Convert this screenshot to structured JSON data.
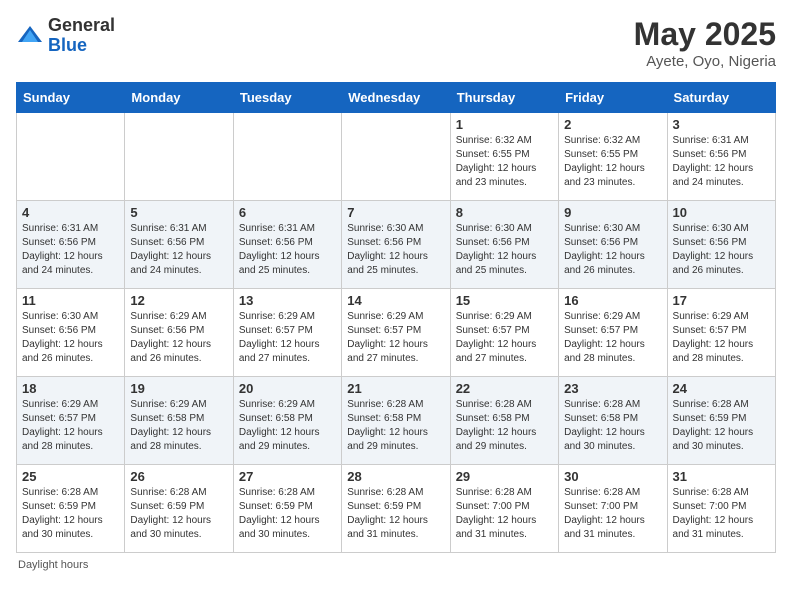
{
  "header": {
    "logo_general": "General",
    "logo_blue": "Blue",
    "month_title": "May 2025",
    "location": "Ayete, Oyo, Nigeria"
  },
  "footer": {
    "label": "Daylight hours"
  },
  "days_of_week": [
    "Sunday",
    "Monday",
    "Tuesday",
    "Wednesday",
    "Thursday",
    "Friday",
    "Saturday"
  ],
  "weeks": [
    [
      {
        "day": "",
        "info": ""
      },
      {
        "day": "",
        "info": ""
      },
      {
        "day": "",
        "info": ""
      },
      {
        "day": "",
        "info": ""
      },
      {
        "day": "1",
        "info": "Sunrise: 6:32 AM\nSunset: 6:55 PM\nDaylight: 12 hours\nand 23 minutes."
      },
      {
        "day": "2",
        "info": "Sunrise: 6:32 AM\nSunset: 6:55 PM\nDaylight: 12 hours\nand 23 minutes."
      },
      {
        "day": "3",
        "info": "Sunrise: 6:31 AM\nSunset: 6:56 PM\nDaylight: 12 hours\nand 24 minutes."
      }
    ],
    [
      {
        "day": "4",
        "info": "Sunrise: 6:31 AM\nSunset: 6:56 PM\nDaylight: 12 hours\nand 24 minutes."
      },
      {
        "day": "5",
        "info": "Sunrise: 6:31 AM\nSunset: 6:56 PM\nDaylight: 12 hours\nand 24 minutes."
      },
      {
        "day": "6",
        "info": "Sunrise: 6:31 AM\nSunset: 6:56 PM\nDaylight: 12 hours\nand 25 minutes."
      },
      {
        "day": "7",
        "info": "Sunrise: 6:30 AM\nSunset: 6:56 PM\nDaylight: 12 hours\nand 25 minutes."
      },
      {
        "day": "8",
        "info": "Sunrise: 6:30 AM\nSunset: 6:56 PM\nDaylight: 12 hours\nand 25 minutes."
      },
      {
        "day": "9",
        "info": "Sunrise: 6:30 AM\nSunset: 6:56 PM\nDaylight: 12 hours\nand 26 minutes."
      },
      {
        "day": "10",
        "info": "Sunrise: 6:30 AM\nSunset: 6:56 PM\nDaylight: 12 hours\nand 26 minutes."
      }
    ],
    [
      {
        "day": "11",
        "info": "Sunrise: 6:30 AM\nSunset: 6:56 PM\nDaylight: 12 hours\nand 26 minutes."
      },
      {
        "day": "12",
        "info": "Sunrise: 6:29 AM\nSunset: 6:56 PM\nDaylight: 12 hours\nand 26 minutes."
      },
      {
        "day": "13",
        "info": "Sunrise: 6:29 AM\nSunset: 6:57 PM\nDaylight: 12 hours\nand 27 minutes."
      },
      {
        "day": "14",
        "info": "Sunrise: 6:29 AM\nSunset: 6:57 PM\nDaylight: 12 hours\nand 27 minutes."
      },
      {
        "day": "15",
        "info": "Sunrise: 6:29 AM\nSunset: 6:57 PM\nDaylight: 12 hours\nand 27 minutes."
      },
      {
        "day": "16",
        "info": "Sunrise: 6:29 AM\nSunset: 6:57 PM\nDaylight: 12 hours\nand 28 minutes."
      },
      {
        "day": "17",
        "info": "Sunrise: 6:29 AM\nSunset: 6:57 PM\nDaylight: 12 hours\nand 28 minutes."
      }
    ],
    [
      {
        "day": "18",
        "info": "Sunrise: 6:29 AM\nSunset: 6:57 PM\nDaylight: 12 hours\nand 28 minutes."
      },
      {
        "day": "19",
        "info": "Sunrise: 6:29 AM\nSunset: 6:58 PM\nDaylight: 12 hours\nand 28 minutes."
      },
      {
        "day": "20",
        "info": "Sunrise: 6:29 AM\nSunset: 6:58 PM\nDaylight: 12 hours\nand 29 minutes."
      },
      {
        "day": "21",
        "info": "Sunrise: 6:28 AM\nSunset: 6:58 PM\nDaylight: 12 hours\nand 29 minutes."
      },
      {
        "day": "22",
        "info": "Sunrise: 6:28 AM\nSunset: 6:58 PM\nDaylight: 12 hours\nand 29 minutes."
      },
      {
        "day": "23",
        "info": "Sunrise: 6:28 AM\nSunset: 6:58 PM\nDaylight: 12 hours\nand 30 minutes."
      },
      {
        "day": "24",
        "info": "Sunrise: 6:28 AM\nSunset: 6:59 PM\nDaylight: 12 hours\nand 30 minutes."
      }
    ],
    [
      {
        "day": "25",
        "info": "Sunrise: 6:28 AM\nSunset: 6:59 PM\nDaylight: 12 hours\nand 30 minutes."
      },
      {
        "day": "26",
        "info": "Sunrise: 6:28 AM\nSunset: 6:59 PM\nDaylight: 12 hours\nand 30 minutes."
      },
      {
        "day": "27",
        "info": "Sunrise: 6:28 AM\nSunset: 6:59 PM\nDaylight: 12 hours\nand 30 minutes."
      },
      {
        "day": "28",
        "info": "Sunrise: 6:28 AM\nSunset: 6:59 PM\nDaylight: 12 hours\nand 31 minutes."
      },
      {
        "day": "29",
        "info": "Sunrise: 6:28 AM\nSunset: 7:00 PM\nDaylight: 12 hours\nand 31 minutes."
      },
      {
        "day": "30",
        "info": "Sunrise: 6:28 AM\nSunset: 7:00 PM\nDaylight: 12 hours\nand 31 minutes."
      },
      {
        "day": "31",
        "info": "Sunrise: 6:28 AM\nSunset: 7:00 PM\nDaylight: 12 hours\nand 31 minutes."
      }
    ]
  ]
}
